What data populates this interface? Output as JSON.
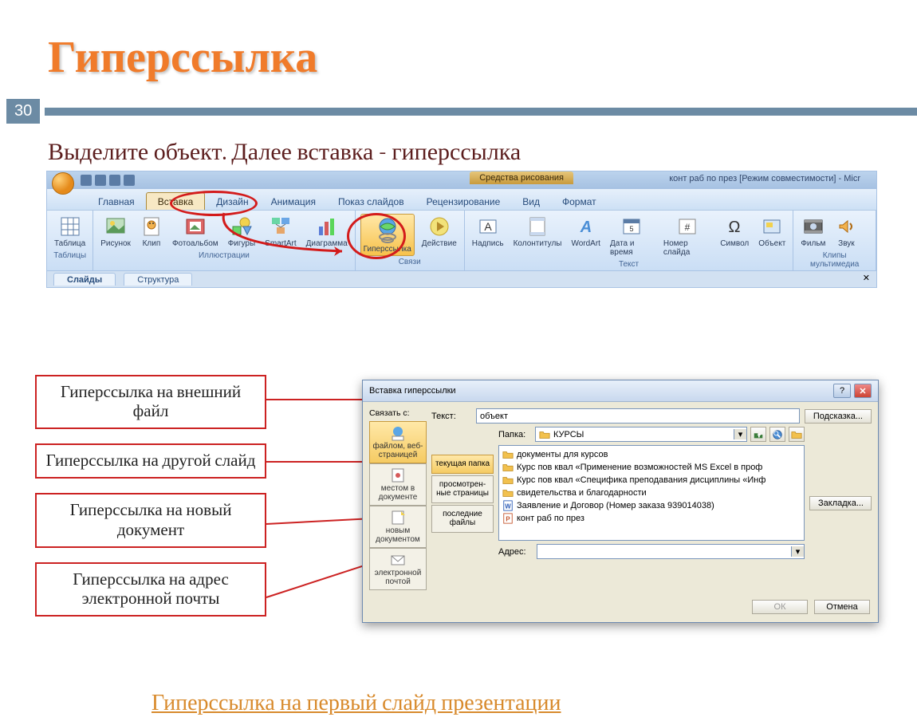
{
  "slide": {
    "title": "Гиперссылка",
    "number": "30",
    "instruction": "Выделите объект. Далее вставка - гиперссылка",
    "bottom_link": "Гиперссылка на первый слайд презентации"
  },
  "ribbon": {
    "context_tab": "Средства рисования",
    "window_title": "конт раб по през [Режим совместимости] - Micr",
    "tabs": [
      "Главная",
      "Вставка",
      "Дизайн",
      "Анимация",
      "Показ слайдов",
      "Рецензирование",
      "Вид",
      "Формат"
    ],
    "active_tab": "Вставка",
    "groups": {
      "tables": {
        "label": "Таблицы",
        "items": [
          "Таблица"
        ]
      },
      "illustrations": {
        "label": "Иллюстрации",
        "items": [
          "Рисунок",
          "Клип",
          "Фотоальбом",
          "Фигуры",
          "SmartArt",
          "Диаграмма"
        ]
      },
      "links": {
        "label": "Связи",
        "items": [
          "Гиперссылка",
          "Действие"
        ]
      },
      "text": {
        "label": "Текст",
        "items": [
          "Надпись",
          "Колонтитулы",
          "WordArt",
          "Дата и время",
          "Номер слайда",
          "Символ",
          "Объект"
        ]
      },
      "media": {
        "label": "Клипы мультимедиа",
        "items": [
          "Фильм",
          "Звук"
        ]
      }
    },
    "pane_tabs": [
      "Слайды",
      "Структура"
    ]
  },
  "callouts": [
    "Гиперссылка на внешний файл",
    "Гиперссылка на другой слайд",
    "Гиперссылка на новый документ",
    "Гиперссылка на адрес электронной почты"
  ],
  "dialog": {
    "title": "Вставка гиперссылки",
    "link_to_label": "Связать с:",
    "link_to": [
      "файлом, веб-страницей",
      "местом в документе",
      "новым документом",
      "электронной почтой"
    ],
    "text_label": "Текст:",
    "text_value": "объект",
    "tip_btn": "Подсказка...",
    "folder_label": "Папка:",
    "folder_value": "КУРСЫ",
    "bookmark_btn": "Закладка...",
    "nav": [
      "текущая папка",
      "просмотрен-ные страницы",
      "последние файлы"
    ],
    "files": [
      {
        "icon": "folder",
        "name": "документы для курсов"
      },
      {
        "icon": "folder",
        "name": "Курс пов квал «Применение возможностей MS Excel в проф"
      },
      {
        "icon": "folder",
        "name": "Курс пов квал «Специфика преподавания дисциплины «Инф"
      },
      {
        "icon": "folder",
        "name": "свидетельства и благодарности"
      },
      {
        "icon": "word",
        "name": "Заявление и Договор (Номер заказа 939014038)"
      },
      {
        "icon": "ppt",
        "name": "конт раб по през"
      }
    ],
    "address_label": "Адрес:",
    "address_value": "",
    "ok": "ОК",
    "cancel": "Отмена"
  }
}
